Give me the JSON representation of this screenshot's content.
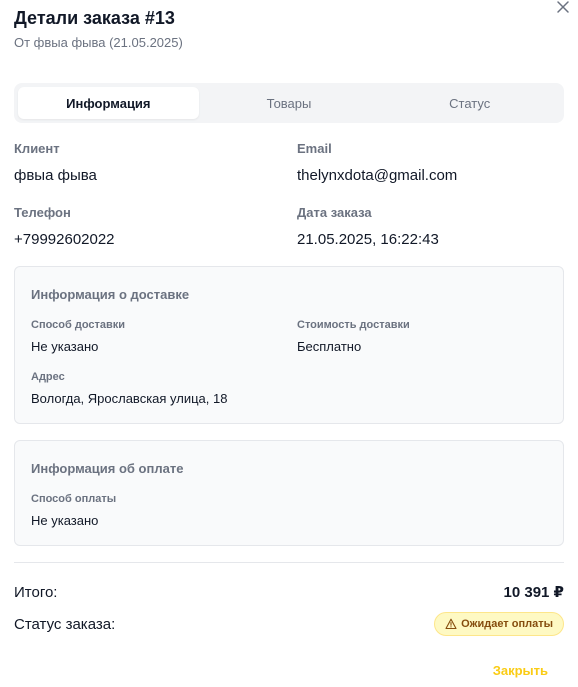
{
  "dialog": {
    "title": "Детали заказа #13",
    "subtitle": "От фвыа фыва (21.05.2025)"
  },
  "tabs": [
    {
      "label": "Информация",
      "active": true
    },
    {
      "label": "Товары",
      "active": false
    },
    {
      "label": "Статус",
      "active": false
    }
  ],
  "info": {
    "client_label": "Клиент",
    "client_value": "фвыа фыва",
    "email_label": "Email",
    "email_value": "thelynxdota@gmail.com",
    "phone_label": "Телефон",
    "phone_value": "+79992602022",
    "date_label": "Дата заказа",
    "date_value": "21.05.2025, 16:22:43"
  },
  "delivery": {
    "title": "Информация о доставке",
    "method_label": "Способ доставки",
    "method_value": "Не указано",
    "cost_label": "Стоимость доставки",
    "cost_value": "Бесплатно",
    "address_label": "Адрес",
    "address_value": "Вологда, Ярославская улица, 18"
  },
  "payment": {
    "title": "Информация об оплате",
    "method_label": "Способ оплаты",
    "method_value": "Не указано"
  },
  "summary": {
    "total_label": "Итого:",
    "total_value": "10 391 ₽",
    "status_label": "Статус заказа:",
    "status_badge": "Ожидает оплаты",
    "status_icon": "warning-icon"
  },
  "footer": {
    "close_label": "Закрыть"
  },
  "colors": {
    "badge_bg": "#fef9c3",
    "badge_text": "#854d0e",
    "close_link": "#facc15"
  }
}
